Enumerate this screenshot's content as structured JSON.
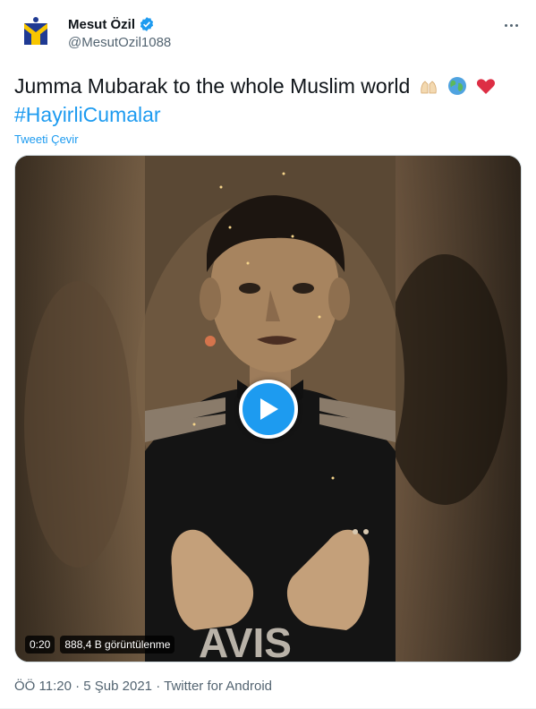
{
  "author": {
    "name": "Mesut Özil",
    "handle": "@MesutOzil1088",
    "verified": true,
    "avatar_icon": "m10-logo-icon"
  },
  "tweet": {
    "text": "Jumma Mubarak to the whole Muslim world",
    "emojis": [
      "praying-hands-icon",
      "globe-icon",
      "red-heart-icon"
    ],
    "hashtag": "#HayirliCumalar",
    "translate_label": "Tweeti Çevir"
  },
  "video": {
    "duration": "0:20",
    "views": "888,4 B görüntülenme"
  },
  "meta": {
    "time": "ÖÖ 11:20",
    "separator1": "·",
    "date": "5 Şub 2021",
    "separator2": "·",
    "source": "Twitter for Android"
  },
  "colors": {
    "accent": "#1d9bf0",
    "text": "#0f1419",
    "secondary": "#536471"
  }
}
